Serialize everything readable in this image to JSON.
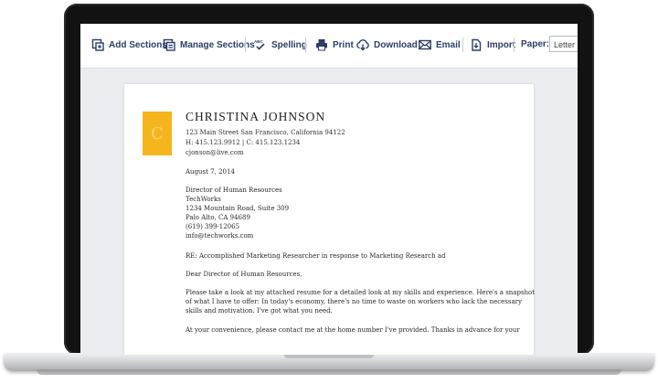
{
  "toolbar": {
    "add_sections": "Add Sections",
    "manage_sections": "Manage Sections",
    "spelling": "Spelling",
    "print": "Print",
    "download": "Download",
    "email": "Email",
    "import": "Import",
    "paper_label": "Paper:",
    "paper_value": "Letter",
    "spelling_icon_text": "ABC"
  },
  "icons": {
    "add_sections": "add-section-icon",
    "manage_sections": "manage-sections-icon",
    "spelling": "spell-check-icon",
    "print": "printer-icon",
    "download": "download-cloud-icon",
    "email": "envelope-icon",
    "import": "import-icon"
  },
  "colors": {
    "toolbar_text": "#2c3e66",
    "monogram_bg": "#f5b51d",
    "screen_bg": "#ecedf1"
  },
  "letter": {
    "monogram": "C",
    "name": "CHRISTINA JOHNSON",
    "address": "123 Main Street San Francisco, California 94122",
    "phones": "H: 415.123.9912  |  C: 415.123.1234",
    "email": "cjonson@live.com",
    "date": "August 7, 2014",
    "recipient": [
      "Director of Human Resources",
      "TechWorks",
      "1234 Mountain Road, Suite 309",
      "Palo Alto, CA 94689",
      "(619) 399-12065",
      "info@techworks.com"
    ],
    "subject": "RE: Accomplished Marketing Researcher in response to Marketing Research ad",
    "salutation": "Dear Director of Human Resources,",
    "paragraph1": [
      "Please take a look at my attached resume for a detailed look at my skills and experience. Here's a snapshot",
      "of what I have to offer: In today's economy, there's no time to waste on workers who lack the necessary",
      "skills and motivation. I've got what you need."
    ],
    "paragraph2": [
      "At your convenience, please contact me at the home number I've provided. Thanks in advance for your"
    ]
  }
}
